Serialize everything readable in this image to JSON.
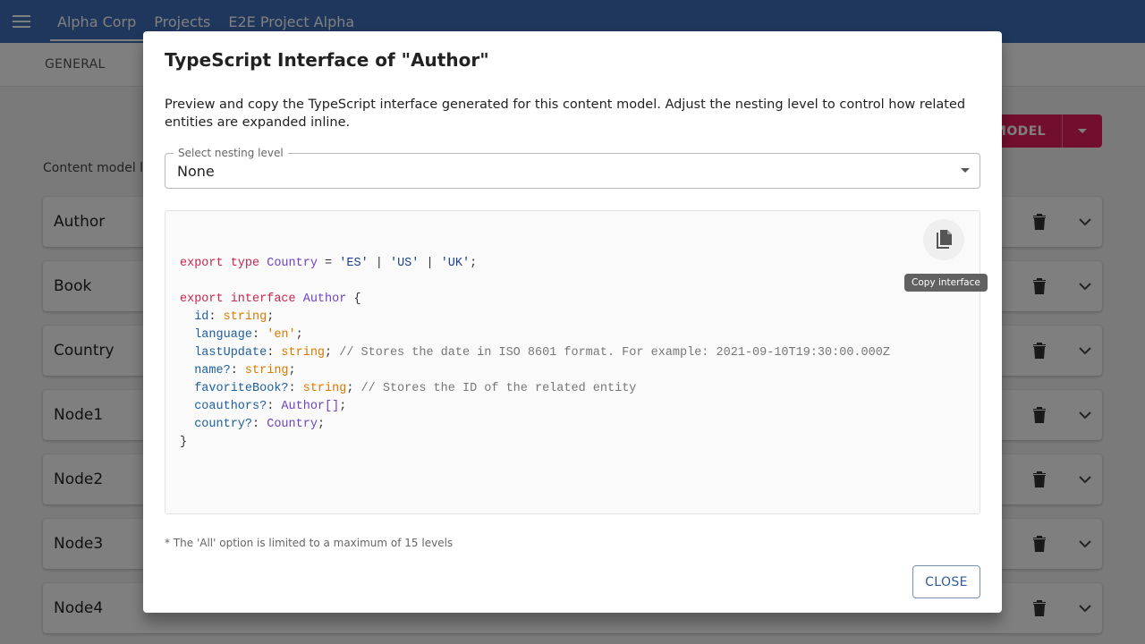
{
  "appbar": {
    "breadcrumbs": [
      "Alpha Corp",
      "Projects",
      "E2E Project Alpha"
    ]
  },
  "subbar": {
    "tab": "GENERAL"
  },
  "background": {
    "add_model_label": "MODEL",
    "section_label": "Content model l",
    "models": [
      "Author",
      "Book",
      "Country",
      "Node1",
      "Node2",
      "Node3",
      "Node4"
    ]
  },
  "dialog": {
    "title": "TypeScript Interface of \"Author\"",
    "description": "Preview and copy the TypeScript interface generated for this content model. Adjust the nesting level to control how related entities are expanded inline.",
    "select": {
      "label": "Select nesting level",
      "value": "None"
    },
    "code": {
      "line1": {
        "kw": "export type",
        "name": "Country",
        "eq": " = ",
        "v1": "'ES'",
        "v2": "'US'",
        "v3": "'UK'"
      },
      "interface_kw": "export interface",
      "interface_name": "Author",
      "fields": [
        {
          "name": "id",
          "type": "string",
          "comment": ""
        },
        {
          "name": "language",
          "type": "'en'",
          "comment": ""
        },
        {
          "name": "lastUpdate",
          "type": "string",
          "comment": "// Stores the date in ISO 8601 format. For example: 2021-09-10T19:30:00.000Z"
        },
        {
          "name": "name?",
          "type": "string",
          "comment": ""
        },
        {
          "name": "favoriteBook?",
          "type": "string",
          "comment": "// Stores the ID of the related entity"
        },
        {
          "name": "coauthors?",
          "type": "Author[]",
          "comment": ""
        },
        {
          "name": "country?",
          "type": "Country",
          "comment": ""
        }
      ]
    },
    "copy_tooltip": "Copy interface",
    "footnote": "* The 'All' option is limited to a maximum of 15 levels",
    "close_label": "CLOSE"
  }
}
